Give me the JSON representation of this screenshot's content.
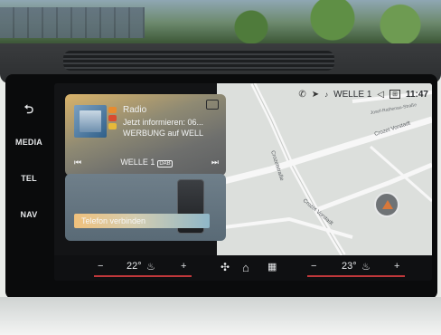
{
  "rail": {
    "back_icon": "back-arrow-icon",
    "items": [
      "MEDIA",
      "TEL",
      "NAV"
    ]
  },
  "status": {
    "station": "WELLE 1",
    "time": "11:47"
  },
  "radio": {
    "title": "Radio",
    "line1": "Jetzt informieren: 06...",
    "line2": "WERBUNG auf WELL",
    "station": "WELLE 1",
    "badge": "DAB"
  },
  "phone": {
    "connect_label": "Telefon verbinden"
  },
  "map": {
    "street1": "Crozet Vorstadt",
    "street2": "Crozet Vorstadt",
    "street3": "Crozetstraße",
    "street4": "Josef-Rathenau-Straße"
  },
  "climate": {
    "left_temp": "22",
    "right_temp": "23",
    "minus": "−",
    "plus": "+"
  },
  "colors": {
    "accent_red": "#c0383b",
    "nav_arrow": "#d9783a"
  }
}
